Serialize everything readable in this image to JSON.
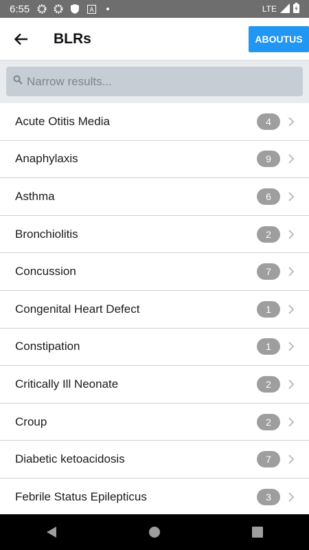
{
  "status_bar": {
    "time": "6:55",
    "network": "LTE",
    "icons": [
      "gear-icon",
      "gear-icon",
      "shield-icon",
      "a-icon",
      "dot-icon"
    ]
  },
  "app_bar": {
    "title": "BLRs",
    "about_label": "ABOUTUS"
  },
  "search": {
    "placeholder": "Narrow results..."
  },
  "list": {
    "items": [
      {
        "label": "Acute Otitis Media",
        "count": "4"
      },
      {
        "label": "Anaphylaxis",
        "count": "9"
      },
      {
        "label": "Asthma",
        "count": "6"
      },
      {
        "label": "Bronchiolitis",
        "count": "2"
      },
      {
        "label": "Concussion",
        "count": "7"
      },
      {
        "label": "Congenital Heart Defect",
        "count": "1"
      },
      {
        "label": "Constipation",
        "count": "1"
      },
      {
        "label": "Critically Ill Neonate",
        "count": "2"
      },
      {
        "label": "Croup",
        "count": "2"
      },
      {
        "label": "Diabetic ketoacidosis",
        "count": "7"
      },
      {
        "label": "Febrile Status Epilepticus",
        "count": "3"
      }
    ]
  },
  "colors": {
    "accent": "#2196f3",
    "badge": "#9e9e9e",
    "status_bar": "#6e6e6e"
  }
}
